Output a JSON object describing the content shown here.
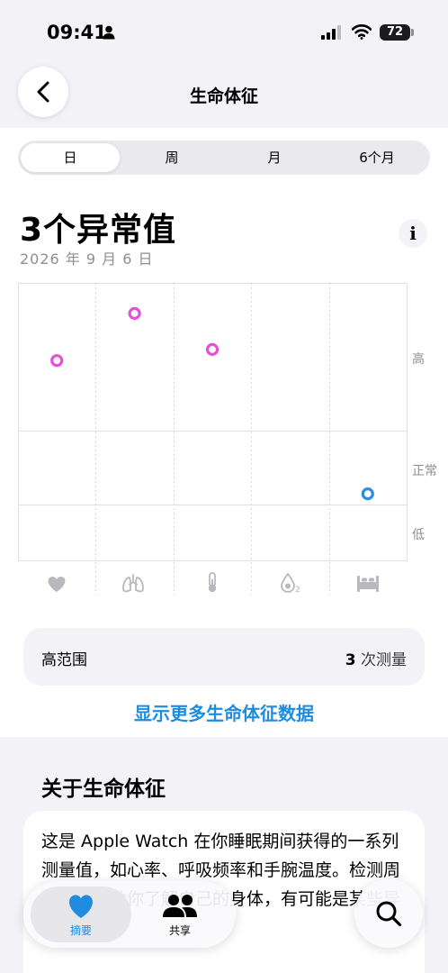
{
  "status_bar": {
    "time": "09:41",
    "battery": "72"
  },
  "nav": {
    "title": "生命体征"
  },
  "tabs": [
    {
      "label": "日",
      "active": true
    },
    {
      "label": "周",
      "active": false
    },
    {
      "label": "月",
      "active": false
    },
    {
      "label": "6个月",
      "active": false
    }
  ],
  "summary": {
    "headline": "3个异常值",
    "date": "2026 年 9 月 6 日"
  },
  "chart_data": {
    "type": "scatter",
    "title": "",
    "bands": [
      "高",
      "正常",
      "低"
    ],
    "categories": [
      "heart-icon",
      "lungs-icon",
      "thermometer-icon",
      "blood-oxygen-icon",
      "bed-icon"
    ],
    "points": [
      {
        "category": 0,
        "value": 0.72,
        "band": "高",
        "color": "#e84fd9"
      },
      {
        "category": 1,
        "value": 0.89,
        "band": "高",
        "color": "#e84fd9"
      },
      {
        "category": 2,
        "value": 0.76,
        "band": "高",
        "color": "#e84fd9"
      },
      {
        "category": 4,
        "value": 0.24,
        "band": "正常",
        "color": "#2a8ee0"
      }
    ]
  },
  "range_card": {
    "label": "高范围",
    "count": "3",
    "unit": " 次测量"
  },
  "more_link": "显示更多生命体征数据",
  "about": {
    "title": "关于生命体征",
    "body": "这是 Apple Watch 在你睡眠期间获得的一系列测量值，如心率、呼吸频率和手腕温度。检测周期可以帮助你了解自己的身体，有可能是某些异常的"
  },
  "tab_bar": {
    "summary_label": "摘要",
    "sharing_label": "共享"
  },
  "colors": {
    "accent": "#1f8ce0",
    "high": "#e84fd9",
    "normal": "#2a8ee0"
  }
}
